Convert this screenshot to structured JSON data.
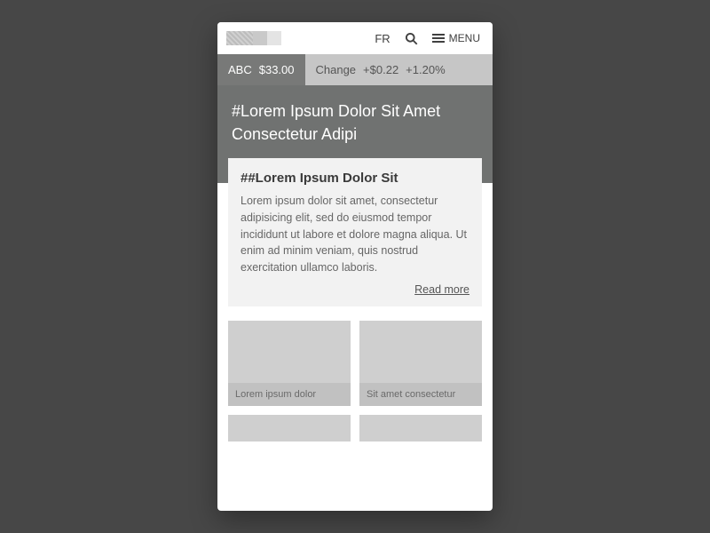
{
  "header": {
    "language": "FR",
    "menu_label": "MENU"
  },
  "ticker": {
    "symbol": "ABC",
    "price": "$33.00",
    "change_label": "Change",
    "change_value": "+$0.22",
    "change_pct": "+1.20%"
  },
  "hero": {
    "headline": "#Lorem Ipsum Dolor Sit Amet Consectetur Adipi"
  },
  "card": {
    "title": "##Lorem Ipsum Dolor Sit",
    "body": "Lorem ipsum dolor sit amet, consectetur adipisicing elit, sed do eiusmod tempor incididunt ut labore et dolore magna aliqua. Ut enim ad minim veniam, quis nostrud exercitation ullamco laboris.",
    "read_more": "Read more"
  },
  "tiles": [
    {
      "caption": "Lorem ipsum dolor"
    },
    {
      "caption": "Sit amet consectetur"
    }
  ]
}
